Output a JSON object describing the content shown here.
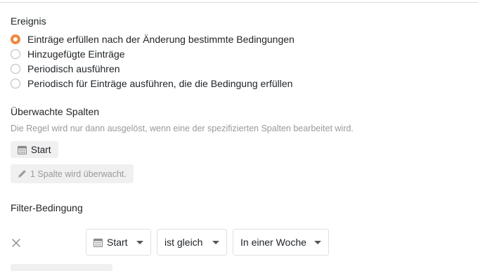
{
  "event": {
    "title": "Ereignis",
    "options": [
      {
        "label": "Einträge erfüllen nach der Änderung bestimmte Bedingungen",
        "checked": true
      },
      {
        "label": "Hinzugefügte Einträge",
        "checked": false
      },
      {
        "label": "Periodisch ausführen",
        "checked": false
      },
      {
        "label": "Periodisch für Einträge ausführen, die die Bedingung erfüllen",
        "checked": false
      }
    ]
  },
  "watched_columns": {
    "title": "Überwachte Spalten",
    "hint": "Die Regel wird nur dann ausgelöst, wenn eine der spezifizierten Spalten bearbeitet wird.",
    "column_chip": {
      "label": "Start",
      "icon": "calendar-icon"
    },
    "edit_button": {
      "label": "1 Spalte wird überwacht.",
      "icon": "pencil-icon"
    }
  },
  "filter": {
    "title": "Filter-Bedingung",
    "remove_icon": "close-icon",
    "column_select": {
      "label": "Start",
      "icon": "calendar-icon"
    },
    "operator_select": {
      "label": "ist gleich"
    },
    "value_select": {
      "label": "In einer Woche"
    }
  },
  "colors": {
    "accent": "#f0883e",
    "muted_text": "#999999",
    "chip_bg": "#f0f0f0"
  }
}
